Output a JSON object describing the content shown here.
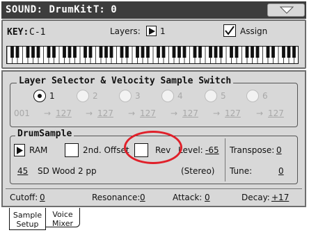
{
  "title": {
    "sound": "SOUND: DrumKit",
    "timbre": "T: 0"
  },
  "key_row": {
    "key_label": "KEY:",
    "key_value": "C-1",
    "layers_label": "Layers:",
    "layers_value": "1",
    "assign_label": "Assign",
    "assign_checked": true
  },
  "layer_selector": {
    "title": "Layer Selector & Velocity Sample Switch",
    "layers": [
      {
        "label": "1",
        "selected": true
      },
      {
        "label": "2",
        "selected": false
      },
      {
        "label": "3",
        "selected": false
      },
      {
        "label": "4",
        "selected": false
      },
      {
        "label": "5",
        "selected": false
      },
      {
        "label": "6",
        "selected": false
      }
    ],
    "velocities": [
      "001",
      "127",
      "127",
      "127",
      "127",
      "127",
      "127"
    ],
    "arrow": "→"
  },
  "drum_sample": {
    "title": "DrumSample",
    "ram_label": "RAM",
    "offset_label": "2nd. Offset",
    "rev_label": "Rev",
    "level_label": "Level:",
    "level_value": "-65",
    "transpose_label": "Transpose:",
    "transpose_value": "0",
    "sample_number": "45",
    "sample_name": "SD Wood 2 pp",
    "stereo": "(Stereo)",
    "tune_label": "Tune:",
    "tune_value": "0"
  },
  "params": {
    "cutoff_label": "Cutoff:",
    "cutoff_value": "0",
    "resonance_label": "Resonance:",
    "resonance_value": "0",
    "attack_label": "Attack:",
    "attack_value": "0",
    "decay_label": "Decay:",
    "decay_value": "+17"
  },
  "tabs": [
    {
      "line1": "Sample",
      "line2": "Setup",
      "active": true
    },
    {
      "line1": "Voice",
      "line2": "Mixer",
      "active": false
    }
  ],
  "icons": {
    "arrow_right": "play-triangle-icon",
    "dropdown": "triangle-down-icon",
    "check": "checkmark-icon"
  },
  "colors": {
    "titlebar": "#3d3d3d",
    "panel": "#d8d8d8",
    "highlight": "#e0202a"
  }
}
